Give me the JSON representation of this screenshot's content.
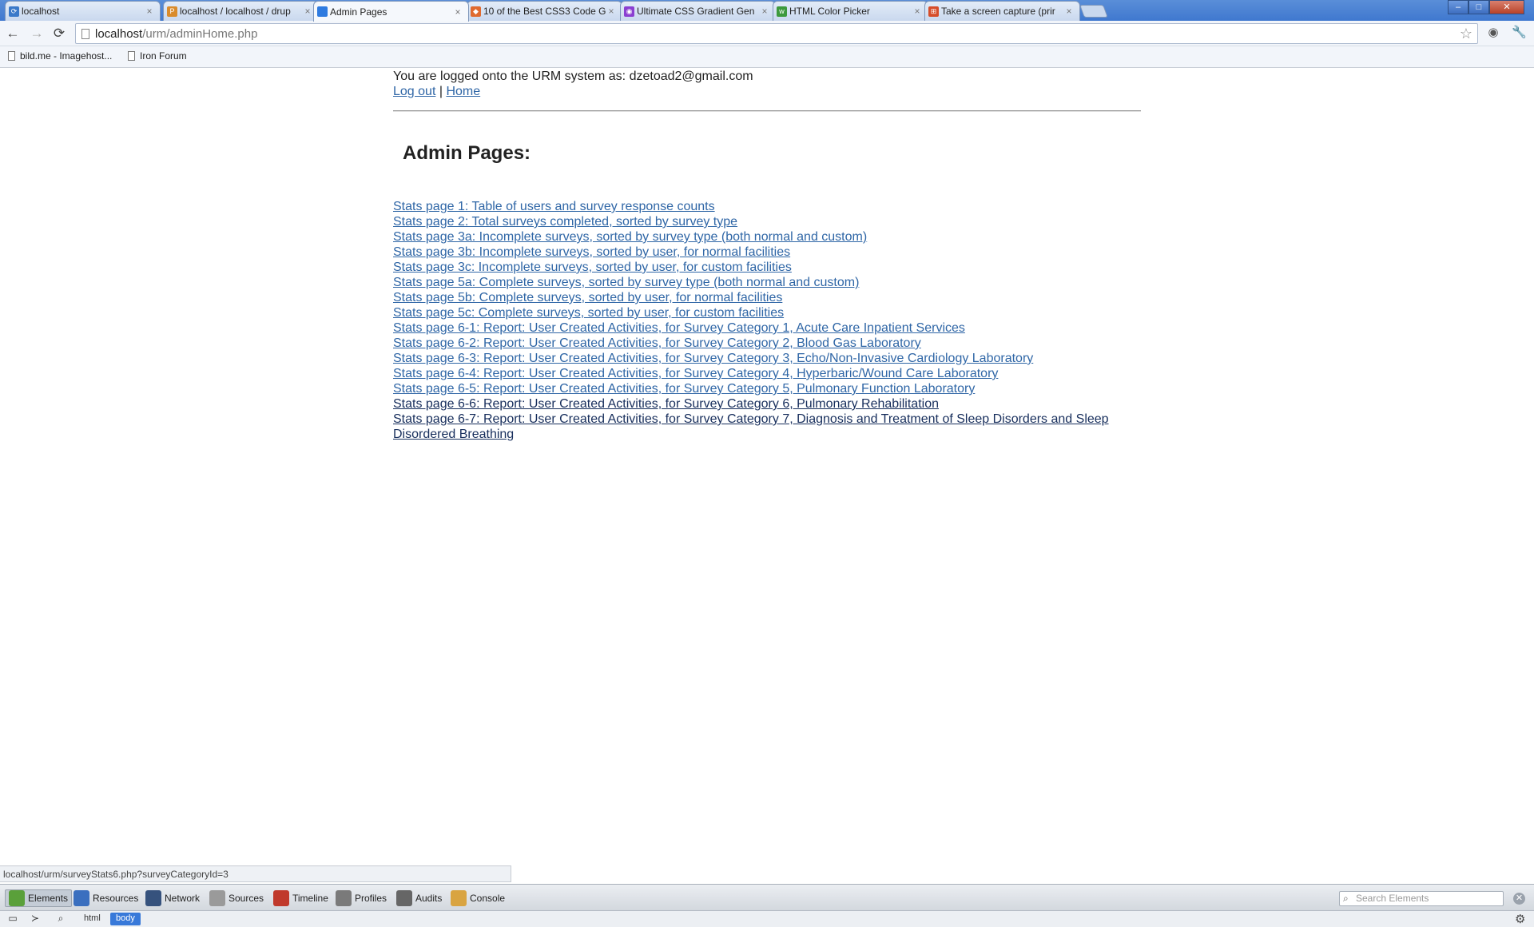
{
  "browser": {
    "tabs": [
      {
        "title": "localhost",
        "close": "×",
        "icon_color": "#3a79c9",
        "icon": "⟳"
      },
      {
        "title": "localhost / localhost / drup",
        "close": "×",
        "icon_color": "#d98b2b",
        "icon": "P"
      },
      {
        "title": "Admin Pages",
        "close": "×",
        "icon_color": "#2e7be0",
        "icon": ""
      },
      {
        "title": "10 of the Best CSS3 Code G",
        "close": "×",
        "icon_color": "#e06a2e",
        "icon": "◆"
      },
      {
        "title": "Ultimate CSS Gradient Gen",
        "close": "×",
        "icon_color": "#8b3fd1",
        "icon": "◉"
      },
      {
        "title": "HTML Color Picker",
        "close": "×",
        "icon_color": "#3d9a3d",
        "icon": "w"
      },
      {
        "title": "Take a screen capture (prir",
        "close": "×",
        "icon_color": "#d64d2a",
        "icon": "⊞"
      }
    ],
    "window_controls": {
      "minimize": "–",
      "maximize": "□",
      "close": "✕"
    },
    "toolbar": {
      "back": "←",
      "forward": "→",
      "reload": "⟳",
      "url_host": "localhost",
      "url_path": "/urm/adminHome.php",
      "bookmark_star": "☆",
      "eye_icon": "◉",
      "wrench_icon": "🔧"
    },
    "bookmarks": [
      {
        "label": "bild.me - Imagehost..."
      },
      {
        "label": "Iron Forum"
      }
    ]
  },
  "page": {
    "login_text": "You are logged onto the URM system as: dzetoad2@gmail.com",
    "logout_link": "Log out",
    "link_separator": "|",
    "home_link": "Home",
    "title": "Admin Pages:",
    "stats_links": [
      {
        "label": "Stats page 1: Table of users and survey response counts",
        "visited": false
      },
      {
        "label": "Stats page 2: Total surveys completed, sorted by survey type",
        "visited": false
      },
      {
        "label": "Stats page 3a: Incomplete surveys, sorted by survey type (both normal and custom)",
        "visited": false
      },
      {
        "label": "Stats page 3b: Incomplete surveys, sorted by user, for normal facilities",
        "visited": false
      },
      {
        "label": "Stats page 3c: Incomplete surveys, sorted by user, for custom facilities",
        "visited": false
      },
      {
        "label": "Stats page 5a: Complete surveys, sorted by survey type (both normal and custom)",
        "visited": false
      },
      {
        "label": "Stats page 5b: Complete surveys, sorted by user, for normal facilities",
        "visited": false
      },
      {
        "label": "Stats page 5c: Complete surveys, sorted by user, for custom facilities",
        "visited": false
      },
      {
        "label": "Stats page 6-1: Report: User Created Activities, for Survey Category 1, Acute Care Inpatient Services",
        "visited": false
      },
      {
        "label": "Stats page 6-2: Report: User Created Activities, for Survey Category 2, Blood Gas Laboratory",
        "visited": false
      },
      {
        "label": "Stats page 6-3: Report: User Created Activities, for Survey Category 3, Echo/Non-Invasive Cardiology Laboratory",
        "visited": false
      },
      {
        "label": "Stats page 6-4: Report: User Created Activities, for Survey Category 4, Hyperbaric/Wound Care Laboratory",
        "visited": false
      },
      {
        "label": "Stats page 6-5: Report: User Created Activities, for Survey Category 5, Pulmonary Function Laboratory",
        "visited": false
      },
      {
        "label": "Stats page 6-6: Report: User Created Activities, for Survey Category 6, Pulmonary Rehabilitation",
        "visited": true
      },
      {
        "label": "Stats page 6-7: Report: User Created Activities, for Survey Category 7, Diagnosis and Treatment of Sleep Disorders and Sleep Disordered Breathing",
        "visited": true
      }
    ]
  },
  "status_bar": {
    "hover_url": "localhost/urm/surveyStats6.php?surveyCategoryId=3"
  },
  "devtools": {
    "tabs": [
      {
        "label": "Elements",
        "icon_color": "#5aa03a",
        "active": true
      },
      {
        "label": "Resources",
        "icon_color": "#3a6fbf",
        "active": false
      },
      {
        "label": "Network",
        "icon_color": "#36527d",
        "active": false
      },
      {
        "label": "Sources",
        "icon_color": "#9a9a9a",
        "active": false
      },
      {
        "label": "Timeline",
        "icon_color": "#c0392b",
        "active": false
      },
      {
        "label": "Profiles",
        "icon_color": "#7a7a7a",
        "active": false
      },
      {
        "label": "Audits",
        "icon_color": "#666666",
        "active": false
      },
      {
        "label": "Console",
        "icon_color": "#d9a441",
        "active": false
      }
    ],
    "search_placeholder": "Search Elements",
    "close_icon": "✕",
    "breadcrumbs": [
      {
        "label": "html",
        "selected": false
      },
      {
        "label": "body",
        "selected": true
      }
    ],
    "bottom_icons": {
      "dock": "▭",
      "console": "≻",
      "search": "⌕",
      "settings": "⚙"
    }
  }
}
